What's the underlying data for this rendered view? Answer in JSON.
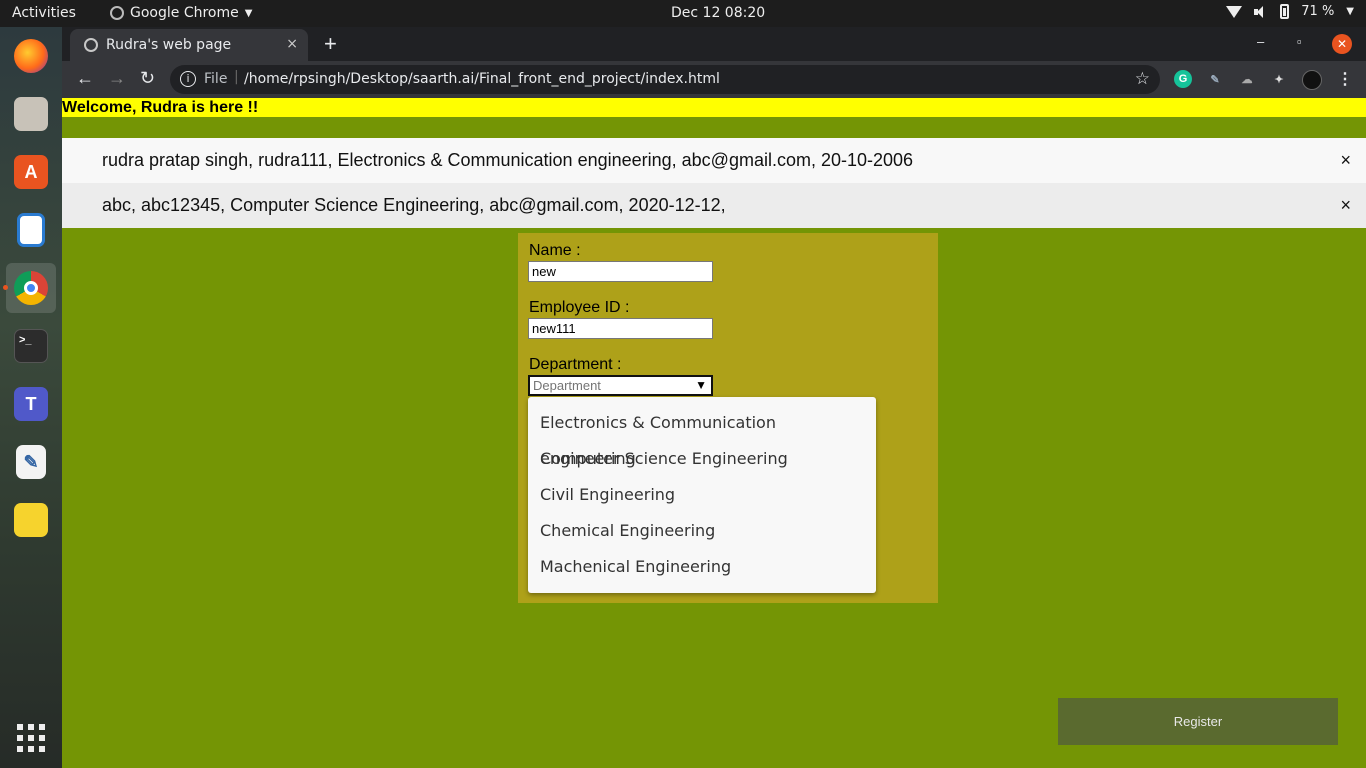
{
  "system": {
    "activities": "Activities",
    "app_name": "Google Chrome",
    "clock": "Dec 12  08:20",
    "battery": "71 %"
  },
  "browser": {
    "tab_title": "Rudra's web page",
    "url_scheme": "File",
    "url": "/home/rpsingh/Desktop/saarth.ai/Final_front_end_project/index.html",
    "new_tab": "+",
    "tab_close": "×",
    "win_minimize": "–",
    "win_restore": "▫",
    "win_close": "✕"
  },
  "page": {
    "welcome": "Welcome, Rudra is here !!",
    "records": [
      {
        "text": "rudra pratap singh, rudra111, Electronics & Communication engineering, abc@gmail.com, 20-10-2006",
        "delete": "×"
      },
      {
        "text": "abc, abc12345, Computer Science Engineering, abc@gmail.com, 2020-12-12,",
        "delete": "×"
      }
    ],
    "form": {
      "name_label": "Name :",
      "name_value": "new",
      "employee_id_label": "Employee ID :",
      "employee_id_value": "new111",
      "department_label": "Department :",
      "department_placeholder": "Department",
      "department_options": [
        "Electronics & Communication engineering",
        "Computer Science Engineering",
        "Civil Engineering",
        "Chemical Engineering",
        "Machenical Engineering"
      ]
    },
    "register_label": "Register"
  },
  "colors": {
    "page_bg": "#749505",
    "welcome_bg": "#ffff00",
    "form_bg": "#aea119",
    "register_bg": "#5a6a2f"
  },
  "dock_icons": [
    "firefox-icon",
    "files-icon",
    "software-icon",
    "writer-icon",
    "chrome-icon",
    "terminal-icon",
    "teams-icon",
    "text-editor-icon",
    "notes-icon",
    "show-apps-icon"
  ]
}
